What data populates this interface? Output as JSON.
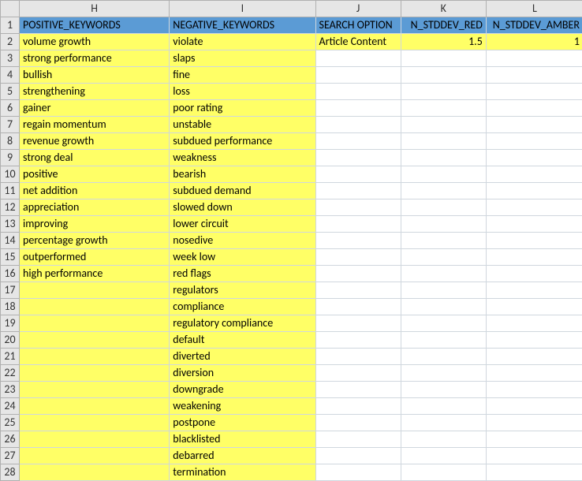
{
  "columns": {
    "letters": [
      "H",
      "I",
      "J",
      "K",
      "L"
    ],
    "headers": {
      "H": "POSITIVE_KEYWORDS",
      "I": "NEGATIVE_KEYWORDS",
      "J": "SEARCH OPTION",
      "K": "N_STDDEV_RED",
      "L": "N_STDDEV_AMBER"
    }
  },
  "data_row": {
    "J": "Article Content",
    "K": "1.5",
    "L": "1"
  },
  "positive_keywords": [
    "volume growth",
    "strong performance",
    "bullish",
    "strengthening",
    "gainer",
    "regain momentum",
    "revenue growth",
    "strong deal",
    "positive",
    "net addition",
    "appreciation",
    "improving",
    "percentage growth",
    "outperformed",
    "high performance"
  ],
  "negative_keywords": [
    "violate",
    "slaps",
    "fine",
    "loss",
    "poor rating",
    "unstable",
    "subdued performance",
    "weakness",
    "bearish",
    "subdued demand",
    "slowed down",
    "lower circuit",
    "nosedive",
    "week low",
    "red flags",
    "regulators",
    "compliance",
    "regulatory compliance",
    "default",
    "diverted",
    "diversion",
    "downgrade",
    "weakening",
    "postpone",
    "blacklisted",
    "debarred",
    "termination"
  ],
  "num_rows": 28,
  "chart_data": {
    "type": "table",
    "title": "",
    "columns": [
      "POSITIVE_KEYWORDS",
      "NEGATIVE_KEYWORDS",
      "SEARCH OPTION",
      "N_STDDEV_RED",
      "N_STDDEV_AMBER"
    ],
    "rows": [
      [
        "volume growth",
        "violate",
        "Article Content",
        1.5,
        1
      ],
      [
        "strong performance",
        "slaps",
        "",
        "",
        ""
      ],
      [
        "bullish",
        "fine",
        "",
        "",
        ""
      ],
      [
        "strengthening",
        "loss",
        "",
        "",
        ""
      ],
      [
        "gainer",
        "poor rating",
        "",
        "",
        ""
      ],
      [
        "regain momentum",
        "unstable",
        "",
        "",
        ""
      ],
      [
        "revenue growth",
        "subdued performance",
        "",
        "",
        ""
      ],
      [
        "strong deal",
        "weakness",
        "",
        "",
        ""
      ],
      [
        "positive",
        "bearish",
        "",
        "",
        ""
      ],
      [
        "net addition",
        "subdued demand",
        "",
        "",
        ""
      ],
      [
        "appreciation",
        "slowed down",
        "",
        "",
        ""
      ],
      [
        "improving",
        "lower circuit",
        "",
        "",
        ""
      ],
      [
        "percentage growth",
        "nosedive",
        "",
        "",
        ""
      ],
      [
        "outperformed",
        "week low",
        "",
        "",
        ""
      ],
      [
        "high performance",
        "red flags",
        "",
        "",
        ""
      ],
      [
        "",
        "regulators",
        "",
        "",
        ""
      ],
      [
        "",
        "compliance",
        "",
        "",
        ""
      ],
      [
        "",
        "regulatory compliance",
        "",
        "",
        ""
      ],
      [
        "",
        "default",
        "",
        "",
        ""
      ],
      [
        "",
        "diverted",
        "",
        "",
        ""
      ],
      [
        "",
        "diversion",
        "",
        "",
        ""
      ],
      [
        "",
        "downgrade",
        "",
        "",
        ""
      ],
      [
        "",
        "weakening",
        "",
        "",
        ""
      ],
      [
        "",
        "postpone",
        "",
        "",
        ""
      ],
      [
        "",
        "blacklisted",
        "",
        "",
        ""
      ],
      [
        "",
        "debarred",
        "",
        "",
        ""
      ],
      [
        "",
        "termination",
        "",
        "",
        ""
      ]
    ]
  }
}
